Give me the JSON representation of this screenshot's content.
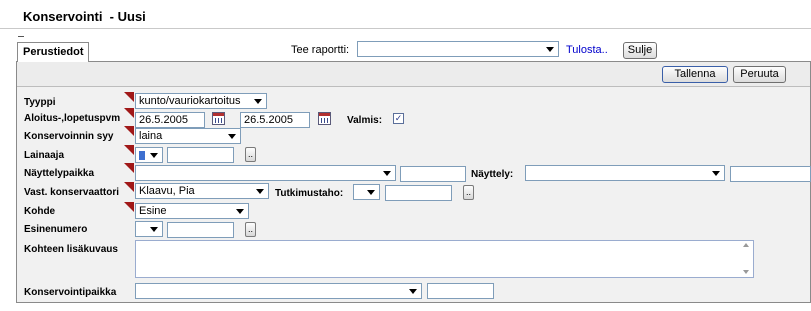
{
  "window": {
    "title": "Konservointi  - Uusi"
  },
  "tabs": [
    {
      "label": "Perustiedot"
    }
  ],
  "report": {
    "label": "Tee raportti:",
    "value": "",
    "print_link": "Tulosta..",
    "close_button": "Sulje"
  },
  "toolbar": {
    "save_button": "Tallenna",
    "cancel_button": "Peruuta"
  },
  "form": {
    "tyyppi": {
      "label": "Tyyppi",
      "value": "kunto/vauriokartoitus"
    },
    "dates": {
      "label": "Aloitus-,lopetuspvm",
      "start": "26.5.2005",
      "end": "26.5.2005",
      "valmis_label": "Valmis:",
      "valmis_checked": true,
      "check_glyph": "✓"
    },
    "syy": {
      "label": "Konservoinnin syy",
      "value": "laina"
    },
    "lainaaja": {
      "label": "Lainaaja",
      "value": "",
      "text": "",
      "button": ".."
    },
    "nayttelypaikka": {
      "label": "Näyttelypaikka",
      "value": "",
      "text": ""
    },
    "nayttely": {
      "label": "Näyttely:",
      "value": "",
      "text": ""
    },
    "konservaattori": {
      "label": "Vast. konservaattori",
      "value": "Klaavu, Pia"
    },
    "tutkimustaho": {
      "label": "Tutkimustaho:",
      "value": "",
      "text": "",
      "button": ".."
    },
    "kohde": {
      "label": "Kohde",
      "value": "Esine"
    },
    "esinenumero": {
      "label": "Esinenumero",
      "value": "",
      "text": "",
      "button": ".."
    },
    "lisakuvaus": {
      "label": "Kohteen lisäkuvaus",
      "value": ""
    },
    "konservointipaikka": {
      "label": "Konservointipaikka",
      "value": "",
      "text": ""
    }
  },
  "colors": {
    "required_marker": "#a01818",
    "link": "#0000cc",
    "panel_bg": "#f1f1f1"
  }
}
